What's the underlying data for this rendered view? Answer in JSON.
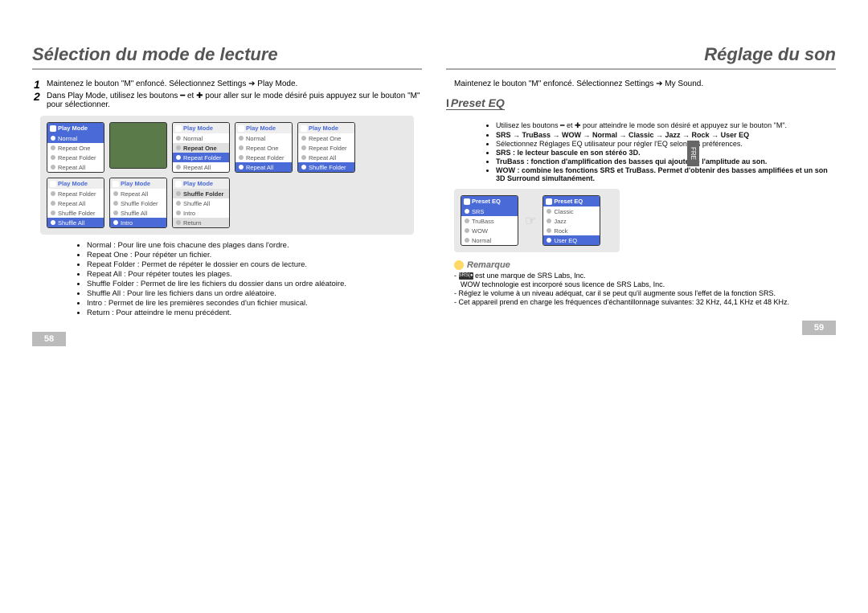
{
  "left": {
    "title": "Sélection du mode de lecture",
    "step1": "Maintenez le bouton \"M\" enfoncé. Sélectionnez Settings ➔ Play Mode.",
    "step2": "Dans Play Mode, utilisez les boutons ━ et ✚ pour aller sur le mode désiré puis appuyez sur le bouton \"M\" pour sélectionner.",
    "panel_title": "Play Mode",
    "opt_normal": "Normal",
    "opt_repeat_one": "Repeat One",
    "opt_repeat_folder": "Repeat Folder",
    "opt_repeat_all": "Repeat All",
    "opt_shuffle_folder": "Shuffle Folder",
    "opt_shuffle_all": "Shuffle All",
    "opt_intro": "Intro",
    "opt_return": "Return",
    "b_normal": "Normal : Pour lire une fois chacune des plages dans l'ordre.",
    "b_repeat_one": "Repeat One : Pour répéter un fichier.",
    "b_repeat_folder": "Repeat Folder : Permet de répéter le dossier en cours de lecture.",
    "b_repeat_all": "Repeat All : Pour répéter toutes les plages.",
    "b_shuffle_folder": "Shuffle Folder : Permet de lire les fichiers du dossier dans un ordre aléatoire.",
    "b_shuffle_all": "Shuffle All : Pour lire les fichiers dans un ordre aléatoire.",
    "b_intro": "Intro : Permet de lire les premières secondes d'un fichier musical.",
    "b_return": "Return : Pour atteindre le menu précédent.",
    "pagenum": "58"
  },
  "right": {
    "title": "Réglage du son",
    "intro": "Maintenez le bouton \"M\" enfoncé. Sélectionnez Settings ➔ My Sound.",
    "section": "Preset EQ",
    "use": "Utilisez les boutons ━ et ✚ pour atteindre le mode son désiré et appuyez sur le bouton \"M\".",
    "opts": "SRS → TruBass → WOW → Normal → Classic → Jazz → Rock → User EQ",
    "user_eq": "Sélectionnez Réglages EQ utilisateur pour régler l'EQ selon vos préférences.",
    "srs_desc": "SRS : le lecteur bascule en son stéréo 3D.",
    "tru_desc": "TruBass : fonction d'amplification des basses qui ajoute de l'amplitude au son.",
    "wow_desc": "WOW : combine les fonctions SRS et TruBass. Permet d'obtenir des basses amplifiées et un son 3D Surround simultanément.",
    "eq_title": "Preset EQ",
    "eq_srs": "SRS",
    "eq_tru": "TruBass",
    "eq_wow": "WOW",
    "eq_normal": "Normal",
    "eq_classic": "Classic",
    "eq_jazz": "Jazz",
    "eq_rock": "Rock",
    "eq_user": "User EQ",
    "remark": "Remarque",
    "n1": "est une marque de SRS Labs, Inc.",
    "n2": "WOW technologie est incorporé sous licence de SRS Labs, Inc.",
    "n3": "- Réglez le volume à un niveau adéquat, car il se peut qu'il augmente sous l'effet de la fonction SRS.",
    "n4": "- Cet appareil prend en charge les fréquences d'échantillonnage suivantes: 32 KHz, 44,1 KHz et 48 KHz.",
    "pagenum": "59",
    "sidetab": "FRE"
  }
}
